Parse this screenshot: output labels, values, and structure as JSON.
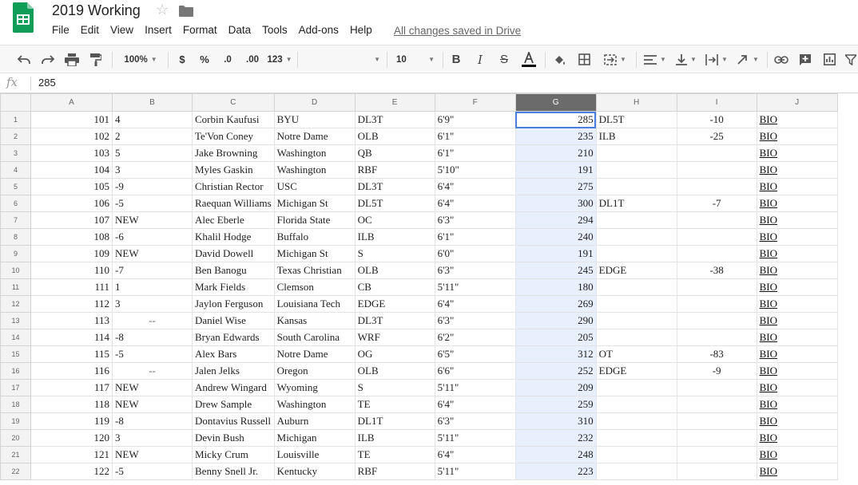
{
  "app": {
    "title": "2019 Working",
    "save_status": "All changes saved in Drive",
    "menus": [
      "File",
      "Edit",
      "View",
      "Insert",
      "Format",
      "Data",
      "Tools",
      "Add-ons",
      "Help"
    ]
  },
  "toolbar": {
    "zoom": "100%",
    "currency": "$",
    "percent": "%",
    "decrease_decimals": ".0",
    "increase_decimals": ".00",
    "more_formats": "123",
    "font_name": "",
    "font_size": "10"
  },
  "formula_bar": {
    "fx_label": "fx",
    "value": "285"
  },
  "colors": {
    "accent": "#4a7de0",
    "selection_fill": "#e8f0fe",
    "header_selected": "#6b6b6b",
    "sheets_green": "#0f9d58"
  },
  "sheet": {
    "selected_cell": "G1",
    "columns": [
      "A",
      "B",
      "C",
      "D",
      "E",
      "F",
      "G",
      "H",
      "I",
      "J"
    ],
    "rows": [
      {
        "n": "1",
        "a": "101",
        "b": "4",
        "c": "Corbin Kaufusi",
        "d": "BYU",
        "e": "DL3T",
        "f": "6'9\"",
        "g": "285",
        "h": "DL5T",
        "i": "-10",
        "j": "BIO"
      },
      {
        "n": "2",
        "a": "102",
        "b": "2",
        "c": "Te'Von Coney",
        "d": "Notre Dame",
        "e": "OLB",
        "f": "6'1\"",
        "g": "235",
        "h": "ILB",
        "i": "-25",
        "j": "BIO"
      },
      {
        "n": "3",
        "a": "103",
        "b": "5",
        "c": "Jake Browning",
        "d": "Washington",
        "e": "QB",
        "f": "6'1\"",
        "g": "210",
        "h": "",
        "i": "",
        "j": "BIO"
      },
      {
        "n": "4",
        "a": "104",
        "b": "3",
        "c": "Myles Gaskin",
        "d": "Washington",
        "e": "RBF",
        "f": "5'10\"",
        "g": "191",
        "h": "",
        "i": "",
        "j": "BIO"
      },
      {
        "n": "5",
        "a": "105",
        "b": "-9",
        "c": "Christian Rector",
        "d": "USC",
        "e": "DL3T",
        "f": "6'4\"",
        "g": "275",
        "h": "",
        "i": "",
        "j": "BIO"
      },
      {
        "n": "6",
        "a": "106",
        "b": "-5",
        "c": "Raequan Williams",
        "d": "Michigan St",
        "e": "DL5T",
        "f": "6'4\"",
        "g": "300",
        "h": "DL1T",
        "i": "-7",
        "j": "BIO"
      },
      {
        "n": "7",
        "a": "107",
        "b": "NEW",
        "c": "Alec Eberle",
        "d": "Florida State",
        "e": "OC",
        "f": "6'3\"",
        "g": "294",
        "h": "",
        "i": "",
        "j": "BIO"
      },
      {
        "n": "8",
        "a": "108",
        "b": "-6",
        "c": "Khalil Hodge",
        "d": "Buffalo",
        "e": "ILB",
        "f": "6'1\"",
        "g": "240",
        "h": "",
        "i": "",
        "j": "BIO"
      },
      {
        "n": "9",
        "a": "109",
        "b": "NEW",
        "c": "David Dowell",
        "d": "Michigan St",
        "e": "S",
        "f": "6'0\"",
        "g": "191",
        "h": "",
        "i": "",
        "j": "BIO"
      },
      {
        "n": "10",
        "a": "110",
        "b": "-7",
        "c": "Ben Banogu",
        "d": "Texas Christian",
        "e": "OLB",
        "f": "6'3\"",
        "g": "245",
        "h": "EDGE",
        "i": "-38",
        "j": "BIO"
      },
      {
        "n": "11",
        "a": "111",
        "b": "1",
        "c": "Mark Fields",
        "d": "Clemson",
        "e": "CB",
        "f": "5'11\"",
        "g": "180",
        "h": "",
        "i": "",
        "j": "BIO"
      },
      {
        "n": "12",
        "a": "112",
        "b": "3",
        "c": "Jaylon Ferguson",
        "d": "Louisiana Tech",
        "e": "EDGE",
        "f": "6'4\"",
        "g": "269",
        "h": "",
        "i": "",
        "j": "BIO"
      },
      {
        "n": "13",
        "a": "113",
        "b": "--",
        "c": "Daniel Wise",
        "d": "Kansas",
        "e": "DL3T",
        "f": "6'3\"",
        "g": "290",
        "h": "",
        "i": "",
        "j": "BIO"
      },
      {
        "n": "14",
        "a": "114",
        "b": "-8",
        "c": "Bryan Edwards",
        "d": "South Carolina",
        "e": "WRF",
        "f": "6'2\"",
        "g": "205",
        "h": "",
        "i": "",
        "j": "BIO"
      },
      {
        "n": "15",
        "a": "115",
        "b": "-5",
        "c": "Alex Bars",
        "d": "Notre Dame",
        "e": "OG",
        "f": "6'5\"",
        "g": "312",
        "h": "OT",
        "i": "-83",
        "j": "BIO"
      },
      {
        "n": "16",
        "a": "116",
        "b": "--",
        "c": "Jalen Jelks",
        "d": "Oregon",
        "e": "OLB",
        "f": "6'6\"",
        "g": "252",
        "h": "EDGE",
        "i": "-9",
        "j": "BIO"
      },
      {
        "n": "17",
        "a": "117",
        "b": "NEW",
        "c": "Andrew Wingard",
        "d": "Wyoming",
        "e": "S",
        "f": "5'11\"",
        "g": "209",
        "h": "",
        "i": "",
        "j": "BIO"
      },
      {
        "n": "18",
        "a": "118",
        "b": "NEW",
        "c": "Drew Sample",
        "d": "Washington",
        "e": "TE",
        "f": "6'4\"",
        "g": "259",
        "h": "",
        "i": "",
        "j": "BIO"
      },
      {
        "n": "19",
        "a": "119",
        "b": "-8",
        "c": "Dontavius Russell",
        "d": "Auburn",
        "e": "DL1T",
        "f": "6'3\"",
        "g": "310",
        "h": "",
        "i": "",
        "j": "BIO"
      },
      {
        "n": "20",
        "a": "120",
        "b": "3",
        "c": "Devin Bush",
        "d": "Michigan",
        "e": "ILB",
        "f": "5'11\"",
        "g": "232",
        "h": "",
        "i": "",
        "j": "BIO"
      },
      {
        "n": "21",
        "a": "121",
        "b": "NEW",
        "c": "Micky Crum",
        "d": "Louisville",
        "e": "TE",
        "f": "6'4\"",
        "g": "248",
        "h": "",
        "i": "",
        "j": "BIO"
      },
      {
        "n": "22",
        "a": "122",
        "b": "-5",
        "c": "Benny Snell Jr.",
        "d": "Kentucky",
        "e": "RBF",
        "f": "5'11\"",
        "g": "223",
        "h": "",
        "i": "",
        "j": "BIO"
      }
    ]
  }
}
